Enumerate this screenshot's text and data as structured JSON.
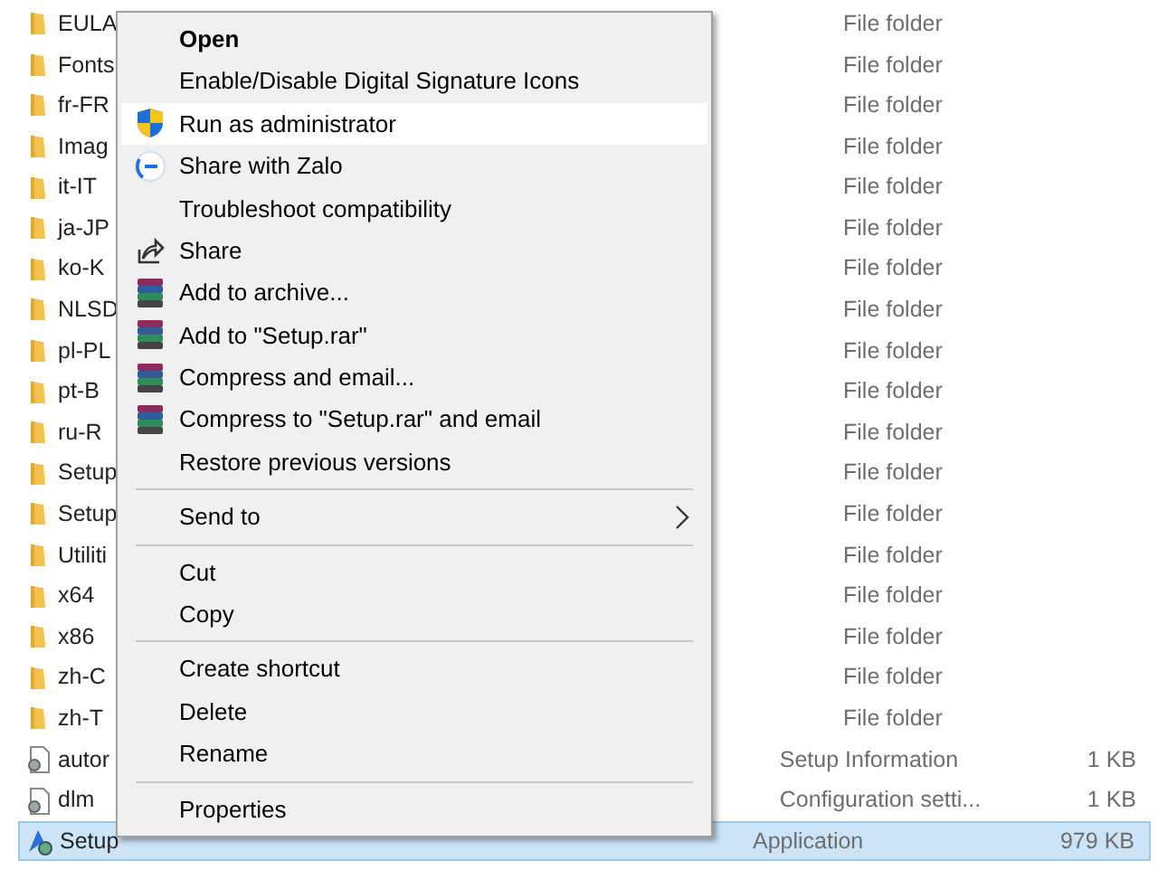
{
  "files": [
    {
      "name": "EULA",
      "type": "File folder",
      "kind": "folder",
      "selected": false
    },
    {
      "name": "Fonts",
      "type": "File folder",
      "kind": "folder",
      "selected": false
    },
    {
      "name": "fr-FR",
      "type": "File folder",
      "kind": "folder",
      "selected": false
    },
    {
      "name": "Imag",
      "type": "File folder",
      "kind": "folder",
      "selected": false
    },
    {
      "name": "it-IT",
      "type": "File folder",
      "kind": "folder",
      "selected": false
    },
    {
      "name": "ja-JP",
      "type": "File folder",
      "kind": "folder",
      "selected": false
    },
    {
      "name": "ko-K",
      "type": "File folder",
      "kind": "folder",
      "selected": false
    },
    {
      "name": "NLSD",
      "type": "File folder",
      "kind": "folder",
      "selected": false
    },
    {
      "name": "pl-PL",
      "type": "File folder",
      "kind": "folder",
      "selected": false
    },
    {
      "name": "pt-B",
      "type": "File folder",
      "kind": "folder",
      "selected": false
    },
    {
      "name": "ru-R",
      "type": "File folder",
      "kind": "folder",
      "selected": false
    },
    {
      "name": "Setup",
      "type": "File folder",
      "kind": "folder",
      "selected": false
    },
    {
      "name": "Setup",
      "type": "File folder",
      "kind": "folder",
      "selected": false
    },
    {
      "name": "Utiliti",
      "type": "File folder",
      "kind": "folder",
      "selected": false
    },
    {
      "name": "x64",
      "type": "File folder",
      "kind": "folder",
      "selected": false
    },
    {
      "name": "x86",
      "type": "File folder",
      "kind": "folder",
      "selected": false
    },
    {
      "name": "zh-C",
      "type": "File folder",
      "kind": "folder",
      "selected": false
    },
    {
      "name": "zh-T",
      "type": "File folder",
      "kind": "folder",
      "selected": false
    },
    {
      "name": "autor",
      "type": "Setup Information",
      "size": "1 KB",
      "kind": "settings-file",
      "selected": false
    },
    {
      "name": "dlm",
      "type": "Configuration setti...",
      "size": "1 KB",
      "kind": "settings-file",
      "selected": false
    },
    {
      "name": "Setup",
      "type": "Application",
      "size": "979 KB",
      "kind": "application",
      "selected": true
    }
  ],
  "context_menu": [
    {
      "kind": "item",
      "label": "Open",
      "bold": true,
      "selected": false
    },
    {
      "kind": "item",
      "label": "Enable/Disable Digital Signature Icons",
      "bold": false,
      "selected": false
    },
    {
      "kind": "shield",
      "label": "Run as administrator",
      "bold": false,
      "selected": true
    },
    {
      "kind": "chat",
      "label": "Share with Zalo",
      "bold": false,
      "selected": false
    },
    {
      "kind": "item",
      "label": "Troubleshoot compatibility",
      "bold": false,
      "selected": false
    },
    {
      "kind": "share",
      "label": "Share",
      "bold": false,
      "selected": false
    },
    {
      "kind": "archive",
      "label": "Add to archive...",
      "bold": false,
      "selected": false
    },
    {
      "kind": "archive",
      "label": "Add to \"Setup.rar\"",
      "bold": false,
      "selected": false
    },
    {
      "kind": "archive",
      "label": "Compress and email...",
      "bold": false,
      "selected": false
    },
    {
      "kind": "archive",
      "label": "Compress to \"Setup.rar\" and email",
      "bold": false,
      "selected": false
    },
    {
      "kind": "item",
      "label": "Restore previous versions",
      "bold": false,
      "selected": false
    },
    {
      "kind": "separator"
    },
    {
      "kind": "submenu",
      "label": "Send to",
      "bold": false,
      "selected": false
    },
    {
      "kind": "separator"
    },
    {
      "kind": "item",
      "label": "Cut",
      "bold": false,
      "selected": false
    },
    {
      "kind": "item",
      "label": "Copy",
      "bold": false,
      "selected": false
    },
    {
      "kind": "separator"
    },
    {
      "kind": "item",
      "label": "Create shortcut",
      "bold": false,
      "selected": false
    },
    {
      "kind": "item",
      "label": "Delete",
      "bold": false,
      "selected": false
    },
    {
      "kind": "item",
      "label": "Rename",
      "bold": false,
      "selected": false
    },
    {
      "kind": "separator"
    },
    {
      "kind": "item",
      "label": "Properties",
      "bold": false,
      "selected": false
    }
  ]
}
